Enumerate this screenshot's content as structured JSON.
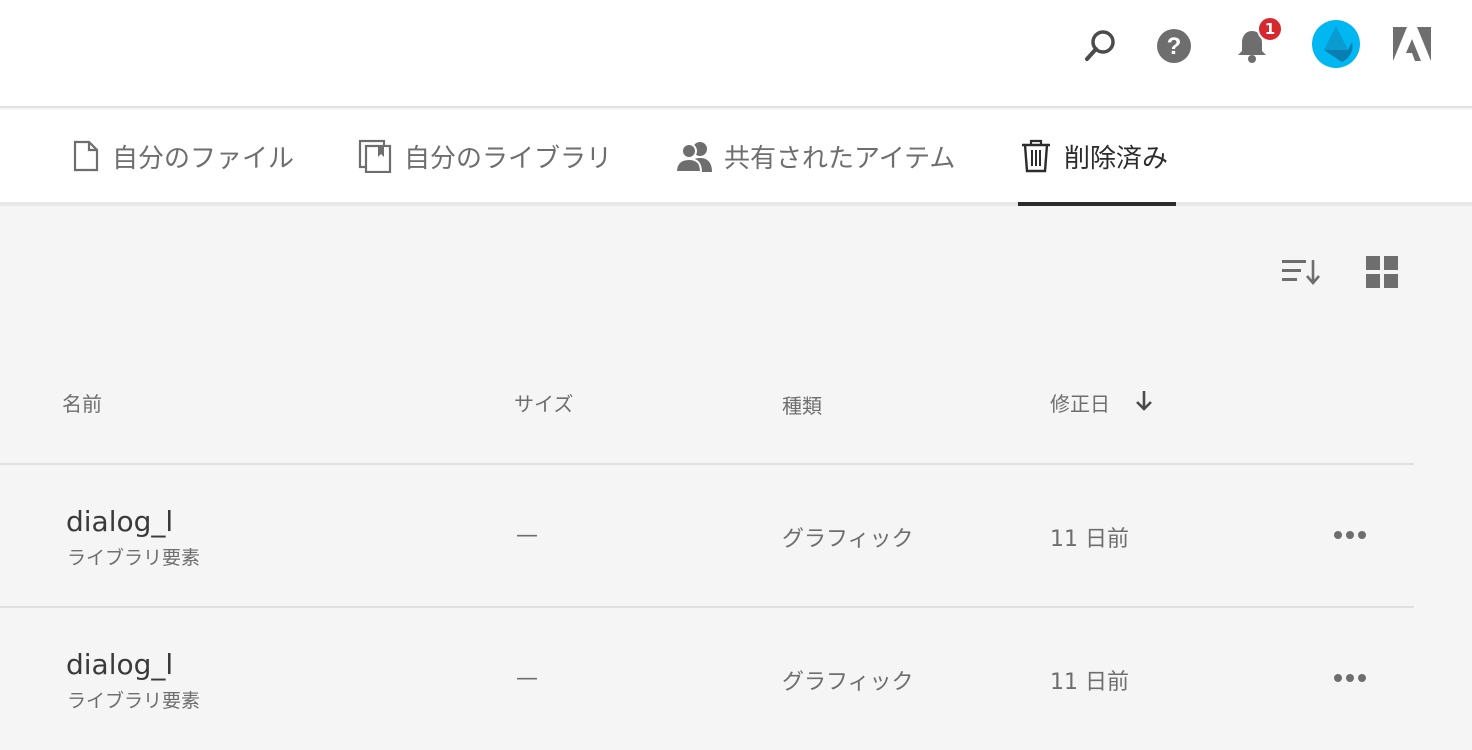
{
  "topbar": {
    "icons": [
      "search-icon",
      "help-icon",
      "bell-icon",
      "avatar",
      "adobe-logo"
    ],
    "notification_count": "1",
    "colors": {
      "badge": "#d7282f",
      "avatar": "#00b7f1"
    }
  },
  "tabs": [
    {
      "label": "自分のファイル",
      "icon": "file-icon",
      "active": false
    },
    {
      "label": "自分のライブラリ",
      "icon": "library-icon",
      "active": false
    },
    {
      "label": "共有されたアイテム",
      "icon": "people-icon",
      "active": false
    },
    {
      "label": "削除済み",
      "icon": "trash-icon",
      "active": true
    }
  ],
  "toolbar": {
    "icons": [
      "sort-icon",
      "grid-view-icon"
    ]
  },
  "table": {
    "columns": [
      "名前",
      "サイズ",
      "種類",
      "修正日"
    ],
    "sorted_column": "修正日",
    "rows": [
      {
        "name": "dialog_l",
        "subtitle": "ライブラリ要素",
        "size": "—",
        "kind": "グラフィック",
        "modified": "11 日前"
      },
      {
        "name": "dialog_l",
        "subtitle": "ライブラリ要素",
        "size": "—",
        "kind": "グラフィック",
        "modified": "11 日前"
      }
    ]
  }
}
